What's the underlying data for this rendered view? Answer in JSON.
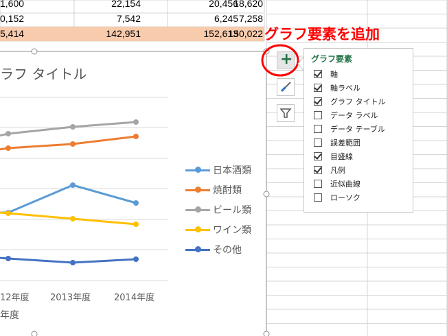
{
  "sheet": {
    "rows": [
      {
        "cells": [
          "1,600",
          "22,154",
          "20,456",
          "18,620"
        ],
        "highlight": false
      },
      {
        "cells": [
          "0,152",
          "7,542",
          "6,245",
          "7,258"
        ],
        "highlight": false
      },
      {
        "cells": [
          "5,414",
          "142,951",
          "152,613",
          "150,022"
        ],
        "highlight": true
      }
    ],
    "highlight_color": "#f8cbad"
  },
  "chart": {
    "title": "ラフ タイトル",
    "x_ticks": [
      "12年度",
      "2013年度",
      "2014年度"
    ],
    "x_axis_label": "年度",
    "legend": [
      {
        "label": "日本酒類",
        "color": "#5b9bd5"
      },
      {
        "label": "焼酎類",
        "color": "#ed7d31"
      },
      {
        "label": "ビール類",
        "color": "#a5a5a5"
      },
      {
        "label": "ワイン類",
        "color": "#ffc000"
      },
      {
        "label": "その他",
        "color": "#4472c4"
      }
    ]
  },
  "chart_data": {
    "type": "line",
    "categories": [
      "12年度",
      "2013年度",
      "2014年度"
    ],
    "series": [
      {
        "name": "日本酒類",
        "values": [
          310,
          270,
          296
        ]
      },
      {
        "name": "焼酎類",
        "values": [
          216,
          210,
          199
        ]
      },
      {
        "name": "ビール類",
        "values": [
          195,
          185,
          178
        ]
      },
      {
        "name": "ワイン類",
        "values": [
          311,
          319,
          327
        ]
      },
      {
        "name": "その他",
        "values": [
          377,
          383,
          378
        ]
      }
    ]
  },
  "side_buttons": [
    {
      "name": "chart-elements-button",
      "icon": "plus-icon"
    },
    {
      "name": "chart-styles-button",
      "icon": "paintbrush-icon"
    },
    {
      "name": "chart-filters-button",
      "icon": "filter-icon"
    }
  ],
  "panel": {
    "title": "グラフ要素",
    "items": [
      {
        "label": "軸",
        "checked": true
      },
      {
        "label": "軸ラベル",
        "checked": true
      },
      {
        "label": "グラフ タイトル",
        "checked": true
      },
      {
        "label": "データ ラベル",
        "checked": false
      },
      {
        "label": "データ テーブル",
        "checked": false
      },
      {
        "label": "誤差範囲",
        "checked": false
      },
      {
        "label": "目盛線",
        "checked": true
      },
      {
        "label": "凡例",
        "checked": true
      },
      {
        "label": "近似曲線",
        "checked": false
      },
      {
        "label": "ローソク",
        "checked": false
      }
    ]
  },
  "annotation": "グラフ要素を追加"
}
